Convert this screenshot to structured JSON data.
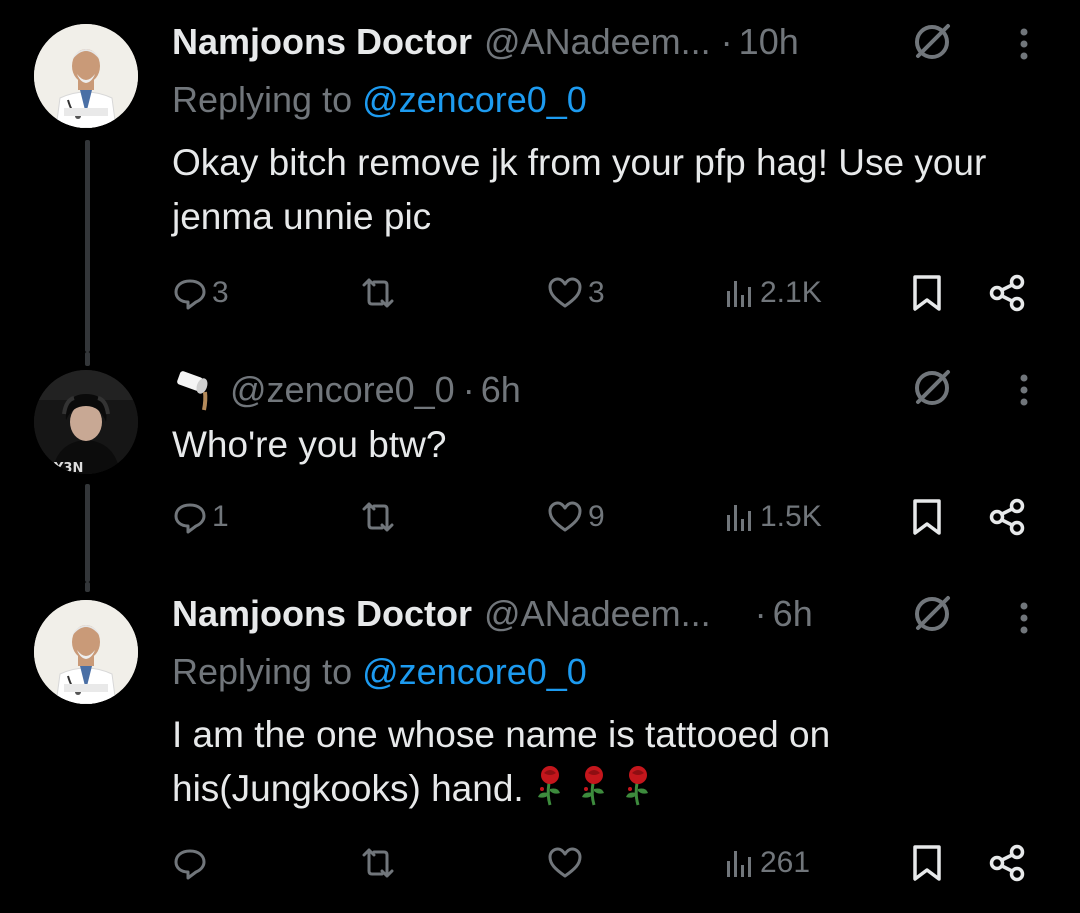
{
  "tweets": [
    {
      "name": "Namjoons Doctor",
      "handle": "@ANadeem...",
      "separator": "·",
      "time": "10h",
      "replying_prefix": "Replying to ",
      "replying_to": "@zencore0_0",
      "text": "Okay bitch remove jk from your pfp hag! Use your jenma unnie pic",
      "replies": "3",
      "retweets": "",
      "likes": "3",
      "views": "2.1K"
    },
    {
      "handle": "@zencore0_0",
      "separator": "·",
      "time": "6h",
      "text": "Who're you btw?",
      "avatar_text": "Y3N",
      "replies": "1",
      "retweets": "",
      "likes": "9",
      "views": "1.5K"
    },
    {
      "name": "Namjoons Doctor",
      "handle": "@ANadeem...",
      "separator": "·",
      "time": "6h",
      "replying_prefix": "Replying to ",
      "replying_to": "@zencore0_0",
      "text": "I am the one whose name is tattooed on his(Jungkooks) hand.",
      "emoji": [
        "wilted-rose",
        "wilted-rose",
        "wilted-rose"
      ],
      "replies": "",
      "retweets": "",
      "likes": "",
      "views": "261"
    }
  ],
  "colors": {
    "background": "#000000",
    "text": "#e7e9ea",
    "secondary": "#71767b",
    "link": "#1d9bf0",
    "thread_line": "#333639"
  }
}
